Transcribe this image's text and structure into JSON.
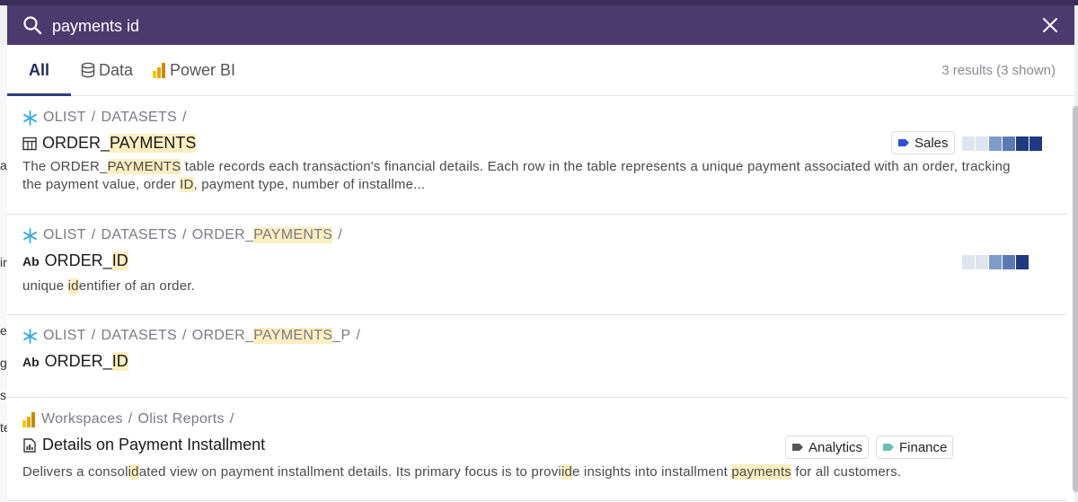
{
  "search": {
    "query": "payments id"
  },
  "tabs": [
    {
      "label": "All",
      "active": true
    },
    {
      "label": "Data",
      "icon": "database-icon"
    },
    {
      "label": "Power BI",
      "icon": "powerbi-icon"
    }
  ],
  "results_count": "3 results (3 shown)",
  "colors": {
    "header": "#4b3a6e",
    "highlight": "#fbeec0",
    "sales_tag": "#2f4fd8",
    "analytics_tag": "#555555",
    "finance_tag": "#6bbfb0",
    "pop_levels": [
      "#dfe5ef",
      "#c7d2e5",
      "#7f9bc9",
      "#5a7ab4",
      "#1f3a80"
    ]
  },
  "results": [
    {
      "crumbs": [
        "OLIST",
        "/",
        "DATASETS",
        "/"
      ],
      "crumb_icon": "snowflake-icon",
      "title": {
        "pre": "ORDER_",
        "hl": "PAYMENTS"
      },
      "title_icon": "table-icon",
      "desc": {
        "p1": "The ORDER_",
        "h1": "PAYMENTS",
        "p2": " table records each transaction's financial details. Each row in the table represents a unique payment associated with an order, tracking the payment value, order ",
        "h2": "ID",
        "p3": ", payment type, number of installme..."
      },
      "tags": [
        "Sales"
      ],
      "popularity": 4
    },
    {
      "crumbs": [
        "OLIST",
        "/",
        "DATASETS",
        "/",
        "ORDER_",
        "PAYMENTS",
        "/"
      ],
      "crumb_icon": "snowflake-icon",
      "title": {
        "pre": "ORDER_",
        "hl": "ID"
      },
      "title_icon": "text-field-icon",
      "title_icon_text": "Ab",
      "desc": {
        "p1": "unique ",
        "h1": "id",
        "p2": "entifier of an order."
      },
      "popularity": 3
    },
    {
      "crumbs": [
        "OLIST",
        "/",
        "DATASETS",
        "/",
        "ORDER_",
        "PAYMENTS",
        "_P",
        "/"
      ],
      "crumb_icon": "snowflake-icon",
      "title": {
        "pre": "ORDER_",
        "hl": "ID"
      },
      "title_icon": "text-field-icon",
      "title_icon_text": "Ab"
    },
    {
      "crumbs": [
        "Workspaces",
        "/",
        "Olist Reports",
        "/"
      ],
      "crumb_icon": "powerbi-icon",
      "title": {
        "text": "Details on Payment Installment"
      },
      "title_icon": "report-icon",
      "desc": {
        "p1": "Delivers a consol",
        "h1": "id",
        "p2": "ated view on payment installment details. Its primary focus is to provi",
        "h2": "id",
        "p3": "e insights into installment ",
        "h3": "payments",
        "p4": " for all customers."
      },
      "tags": [
        "Analytics",
        "Finance"
      ]
    }
  ],
  "background_edge_letters": [
    "a",
    "ir",
    "e",
    "g",
    "s",
    "te"
  ]
}
